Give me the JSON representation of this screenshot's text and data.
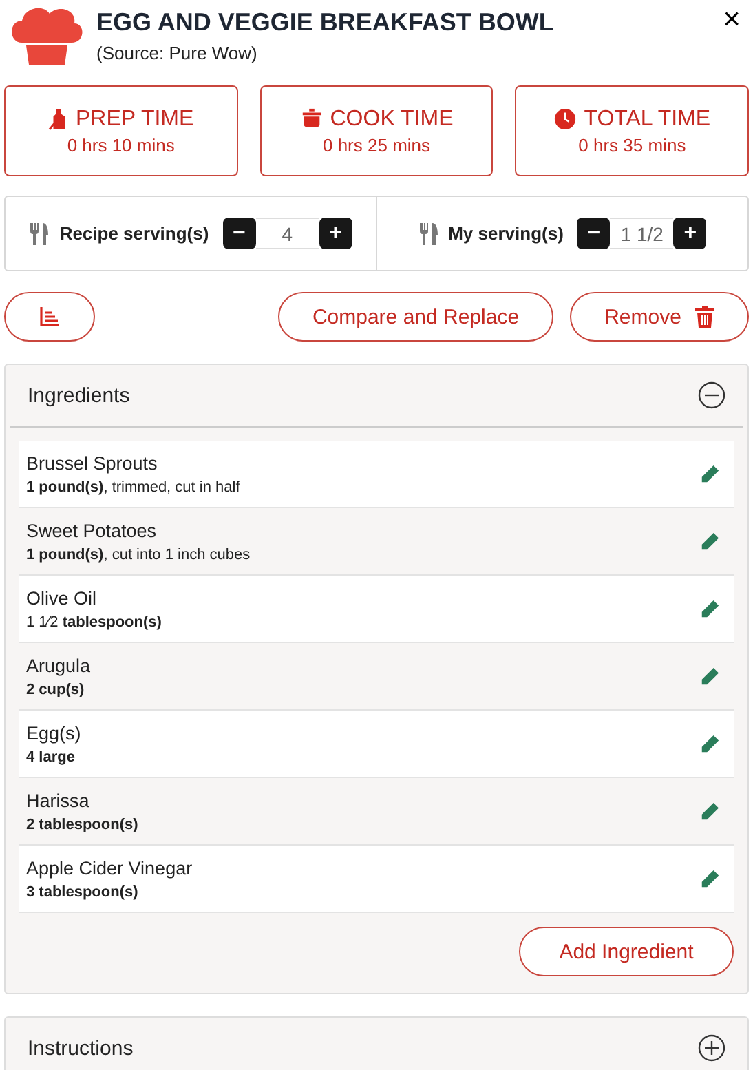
{
  "header": {
    "title": "EGG AND VEGGIE BREAKFAST BOWL",
    "source": "(Source: Pure Wow)",
    "close": "×"
  },
  "times": [
    {
      "kind": "prep",
      "label": "PREP TIME",
      "value": "0 hrs 10 mins"
    },
    {
      "kind": "cook",
      "label": "COOK TIME",
      "value": "0 hrs 25 mins"
    },
    {
      "kind": "total",
      "label": "TOTAL TIME",
      "value": "0 hrs 35 mins"
    }
  ],
  "servings": [
    {
      "label": "Recipe serving(s)",
      "minus": "−",
      "value": "4",
      "plus": "+"
    },
    {
      "label": "My serving(s)",
      "minus": "−",
      "value": "1 1/2",
      "plus": "+"
    }
  ],
  "actions": {
    "compare": "Compare and Replace",
    "remove": "Remove"
  },
  "sections": [
    {
      "title": "Ingredients",
      "expanded": true,
      "items": [
        {
          "name": "Brussel Sprouts",
          "detail": "**1 pound(s)**, trimmed, cut in half"
        },
        {
          "name": "Sweet Potatoes",
          "detail": "**1 pound(s)**, cut into 1 inch cubes"
        },
        {
          "name": "Olive Oil",
          "detail": "1 1⁄2 **tablespoon(s)**"
        },
        {
          "name": "Arugula",
          "detail": "**2 cup(s)**"
        },
        {
          "name": "Egg(s)",
          "detail": "**4 large**"
        },
        {
          "name": "Harissa",
          "detail": "**2 tablespoon(s)**"
        },
        {
          "name": "Apple Cider Vinegar",
          "detail": "**3 tablespoon(s)**"
        }
      ],
      "add": "Add Ingredient"
    },
    {
      "title": "Instructions",
      "expanded": false
    }
  ]
}
